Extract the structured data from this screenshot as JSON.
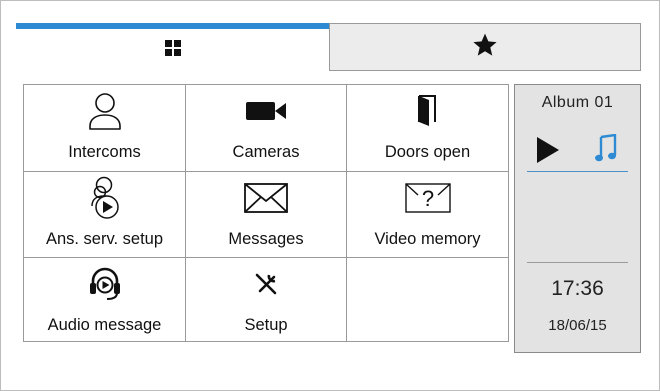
{
  "tabs": [
    {
      "icon": "grid-icon",
      "active": true
    },
    {
      "icon": "star-icon",
      "active": false
    }
  ],
  "accent_color": "#2e8bd3",
  "menu": [
    {
      "label": "Intercoms",
      "icon": "user-icon"
    },
    {
      "label": "Cameras",
      "icon": "camera-icon"
    },
    {
      "label": "Doors open",
      "icon": "door-icon"
    },
    {
      "label": "Ans. serv. setup",
      "icon": "answering-service-icon"
    },
    {
      "label": "Messages",
      "icon": "envelope-icon"
    },
    {
      "label": "Video memory",
      "icon": "video-memory-icon"
    },
    {
      "label": "Audio message",
      "icon": "headset-play-icon"
    },
    {
      "label": "Setup",
      "icon": "tools-icon"
    },
    {
      "label": "",
      "icon": ""
    }
  ],
  "sidebar": {
    "album": "Album 01",
    "time": "17:36",
    "date": "18/06/15"
  }
}
